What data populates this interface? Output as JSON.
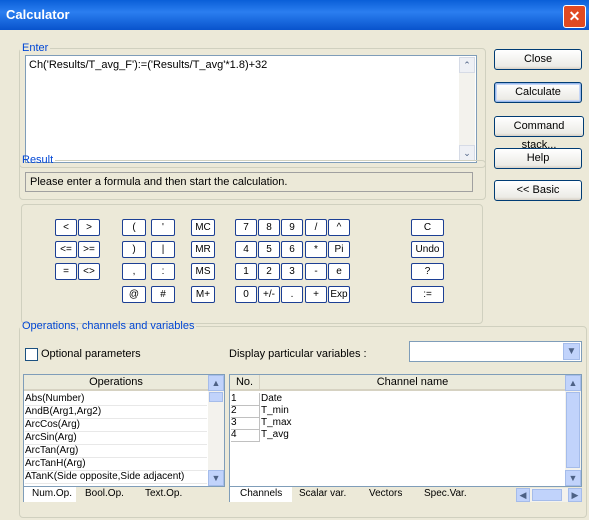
{
  "window": {
    "title": "Calculator",
    "close_glyph": "✕"
  },
  "enter": {
    "legend": "Enter",
    "formula": "Ch('Results/T_avg_F'):=('Results/T_avg'*1.8)+32"
  },
  "result": {
    "legend": "Result",
    "message": "Please enter a formula and then start the calculation."
  },
  "side_buttons": {
    "close": "Close",
    "calculate": "Calculate",
    "command_stack": "Command stack...",
    "help": "Help",
    "basic": "<< Basic"
  },
  "keypad": {
    "ops1": [
      "<",
      ">",
      "<=",
      ">=",
      "=",
      "<>"
    ],
    "ops2": [
      "(",
      "'",
      ")",
      "|",
      ",",
      ":",
      "@",
      "#"
    ],
    "mem": [
      "MC",
      "MR",
      "MS",
      "M+"
    ],
    "num": [
      "7",
      "8",
      "9",
      "/",
      "^",
      "4",
      "5",
      "6",
      "*",
      "Pi",
      "1",
      "2",
      "3",
      "-",
      "e",
      "0",
      "+/-",
      ".",
      "+",
      "Exp"
    ],
    "right": [
      "C",
      "Undo",
      "?",
      ":="
    ]
  },
  "ocv": {
    "legend": "Operations, channels and variables",
    "optional_params": "Optional parameters",
    "display_label": "Display particular variables :",
    "display_value": ""
  },
  "operations": {
    "header": "Operations",
    "items": [
      "Abs(Number)",
      "AndB(Arg1,Arg2)",
      "ArcCos(Arg)",
      "ArcSin(Arg)",
      "ArcTan(Arg)",
      "ArcTanH(Arg)",
      "ATanK(Side opposite,Side adjacent)"
    ],
    "tabs": [
      "Num.Op.",
      "Bool.Op.",
      "Text.Op."
    ]
  },
  "channels": {
    "col_no": "No.",
    "col_name": "Channel name",
    "rows": [
      {
        "no": "1",
        "name": "Date"
      },
      {
        "no": "2",
        "name": "T_min"
      },
      {
        "no": "3",
        "name": "T_max"
      },
      {
        "no": "4",
        "name": "T_avg"
      }
    ],
    "tabs": [
      "Channels",
      "Scalar var.",
      "Vectors",
      "Spec.Var."
    ]
  }
}
